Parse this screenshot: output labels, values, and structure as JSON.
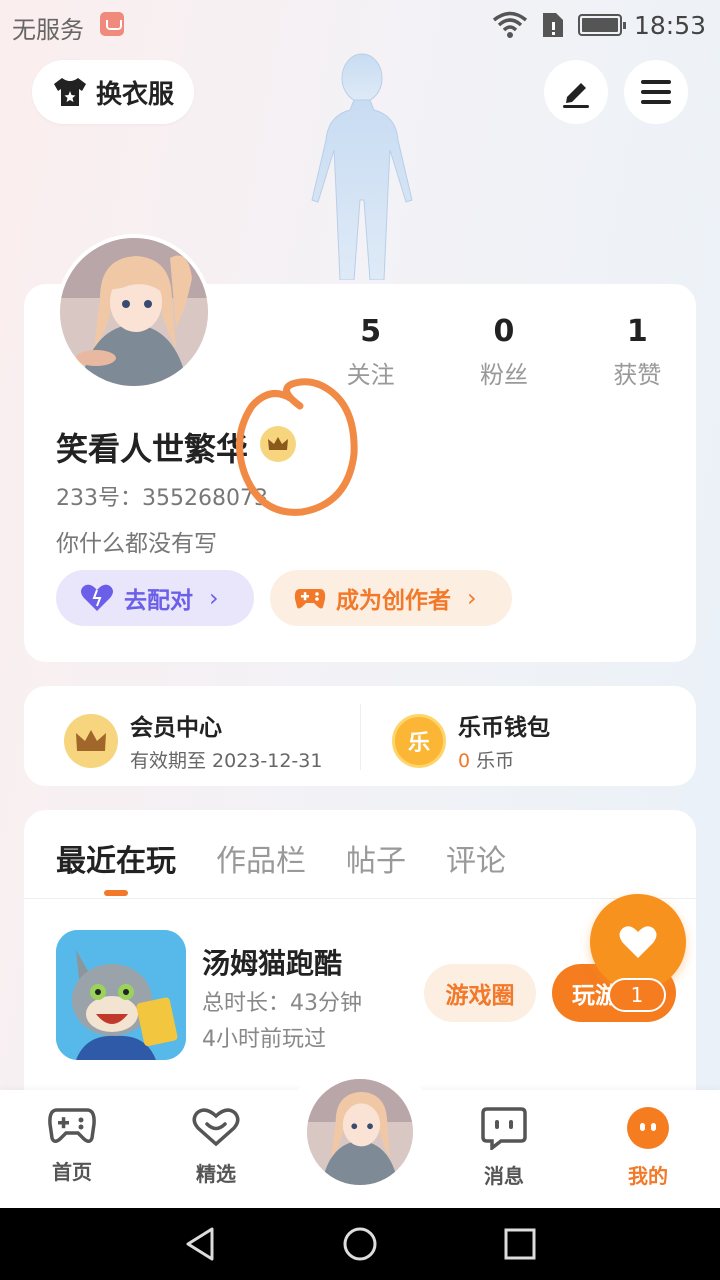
{
  "status_bar": {
    "carrier": "无服务",
    "time": "18:53"
  },
  "top": {
    "outfit_label": "换衣服"
  },
  "profile": {
    "stats": [
      {
        "value": "5",
        "label": "关注"
      },
      {
        "value": "0",
        "label": "粉丝"
      },
      {
        "value": "1",
        "label": "获赞"
      }
    ],
    "username": "笑看人世繁华",
    "uid": "233号：355268073",
    "bio": "你什么都没有写",
    "match_label": "去配对",
    "creator_label": "成为创作者"
  },
  "vip": {
    "title": "会员中心",
    "subtitle": "有效期至 2023-12-31",
    "wallet_title": "乐币钱包",
    "wallet_amount": "0",
    "wallet_unit": " 乐币",
    "coin_char": "乐"
  },
  "tabs": [
    "最近在玩",
    "作品栏",
    "帖子",
    "评论"
  ],
  "recent_game": {
    "name": "汤姆猫跑酷",
    "duration": "总时长：43分钟",
    "last_played": "4小时前玩过",
    "circle_button": "游戏圈",
    "play_button": "玩游戏"
  },
  "fab": {
    "count": "1"
  },
  "bottom_nav": [
    "首页",
    "精选",
    "消息",
    "我的"
  ],
  "colors": {
    "accent": "#f2792a",
    "purple": "#6b5ee8",
    "gold": "#f7d57e"
  }
}
